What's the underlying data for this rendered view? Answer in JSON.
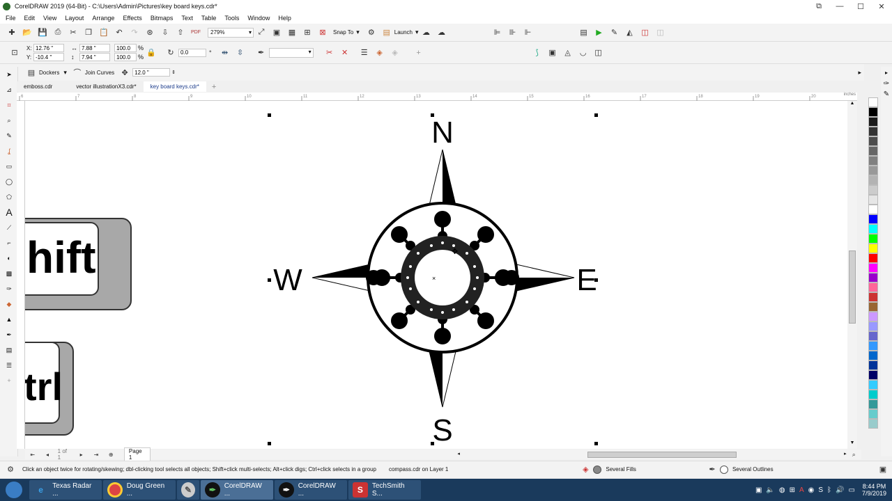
{
  "window": {
    "title": "CorelDRAW 2019 (64-Bit) - C:\\Users\\Admin\\Pictures\\key board keys.cdr*"
  },
  "menu": [
    "File",
    "Edit",
    "View",
    "Layout",
    "Arrange",
    "Effects",
    "Bitmaps",
    "Text",
    "Table",
    "Tools",
    "Window",
    "Help"
  ],
  "toolbar": {
    "zoom": "279%",
    "snap_to": "Snap To",
    "launch": "Launch"
  },
  "propbar": {
    "x": "12.76 \"",
    "y": "-10.4 \"",
    "w": "7.88 \"",
    "h": "7.94 \"",
    "sx": "100.0",
    "sy": "100.0",
    "pct1": "%",
    "pct2": "%",
    "rotation": "0.0",
    "rotation_unit": "°"
  },
  "propbar2": {
    "dockers": "Dockers",
    "join_curves": "Join Curves",
    "threshold": "12.0 \""
  },
  "tabs": [
    {
      "label": "emboss.cdr"
    },
    {
      "label": "vector illustrationX3.cdr*"
    },
    {
      "label": "key board keys.cdr*"
    }
  ],
  "ruler": {
    "unit": "inches",
    "ticks": [
      "6",
      "7",
      "8",
      "9",
      "10",
      "11",
      "12",
      "13",
      "14",
      "15",
      "16",
      "17",
      "18",
      "19",
      "20"
    ]
  },
  "canvas": {
    "compass": {
      "north": "N",
      "south": "S",
      "east": "E",
      "west": "W"
    },
    "key_shift": "hift",
    "key_ctrl": "trl"
  },
  "pagebar": {
    "page_of": "1 of 1",
    "page_tab": "Page 1"
  },
  "status": {
    "hint": "Click an object twice for rotating/skewing; dbl-clicking tool selects all objects; Shift+click multi-selects; Alt+click digs; Ctrl+click selects in a group",
    "object": "compass.cdr on Layer 1",
    "fills": "Several Fills",
    "outlines": "Several Outlines"
  },
  "palette": [
    "#ffffff",
    "#000000",
    "#1a1a1a",
    "#333333",
    "#4d4d4d",
    "#666666",
    "#808080",
    "#999999",
    "#b3b3b3",
    "#cccccc",
    "#e6e6e6",
    "#ffffff",
    "#0000ff",
    "#00ffff",
    "#00ff00",
    "#ffff00",
    "#ff0000",
    "#ff00ff",
    "#9900cc",
    "#ff6699",
    "#cc3333",
    "#996633",
    "#cc99ff",
    "#9999ff",
    "#6666cc",
    "#3399ff",
    "#0066cc",
    "#003399",
    "#000066",
    "#33ccff",
    "#00cccc",
    "#339999",
    "#66cccc",
    "#99cccc"
  ],
  "taskbar": {
    "items": [
      {
        "label": "Texas Radar ..."
      },
      {
        "label": "Doug Green ..."
      },
      {
        "label": "CorelDRAW ..."
      },
      {
        "label": "CorelDRAW ..."
      },
      {
        "label": "TechSmith S..."
      }
    ],
    "time": "8:44 PM",
    "date": "7/9/2019"
  }
}
